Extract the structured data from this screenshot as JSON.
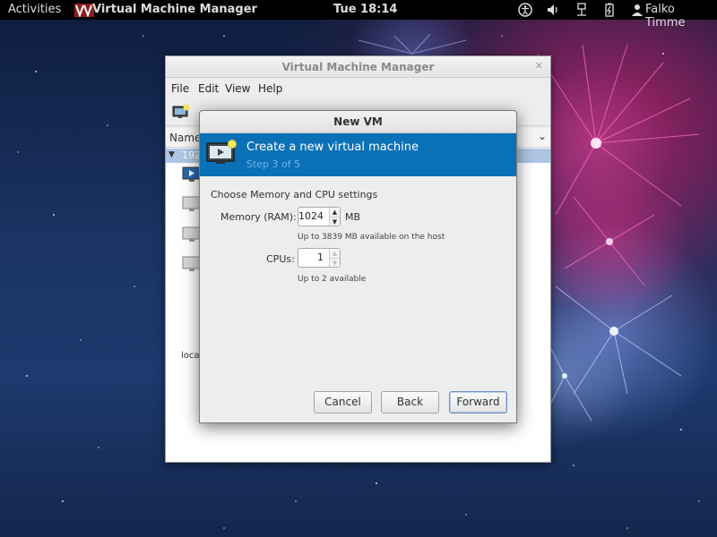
{
  "topbar": {
    "activities": "Activities",
    "app_name": "Virtual Machine Manager",
    "clock": "Tue 18:14",
    "user": "Falko Timme",
    "tray_icons": [
      "accessibility-icon",
      "volume-icon",
      "network-icon",
      "battery-icon",
      "user-icon"
    ]
  },
  "main_window": {
    "title": "Virtual Machine Manager",
    "menu": [
      "File",
      "Edit",
      "View",
      "Help"
    ],
    "list_header": "Name",
    "connection": "192",
    "local_label": "local"
  },
  "dialog": {
    "title": "New VM",
    "banner_title": "Create a new virtual machine",
    "banner_step": "Step 3 of 5",
    "section": "Choose Memory and CPU settings",
    "memory_label": "Memory (RAM):",
    "memory_value": "1024",
    "memory_unit": "MB",
    "memory_hint": "Up to 3839 MB available on the host",
    "cpus_label": "CPUs:",
    "cpus_value": "1",
    "cpus_hint": "Up to 2 available",
    "buttons": {
      "cancel": "Cancel",
      "back": "Back",
      "forward": "Forward"
    }
  },
  "colors": {
    "banner": "#0b71b6",
    "banner_step": "#6fb3e8",
    "selected_row": "#aec6e2"
  }
}
